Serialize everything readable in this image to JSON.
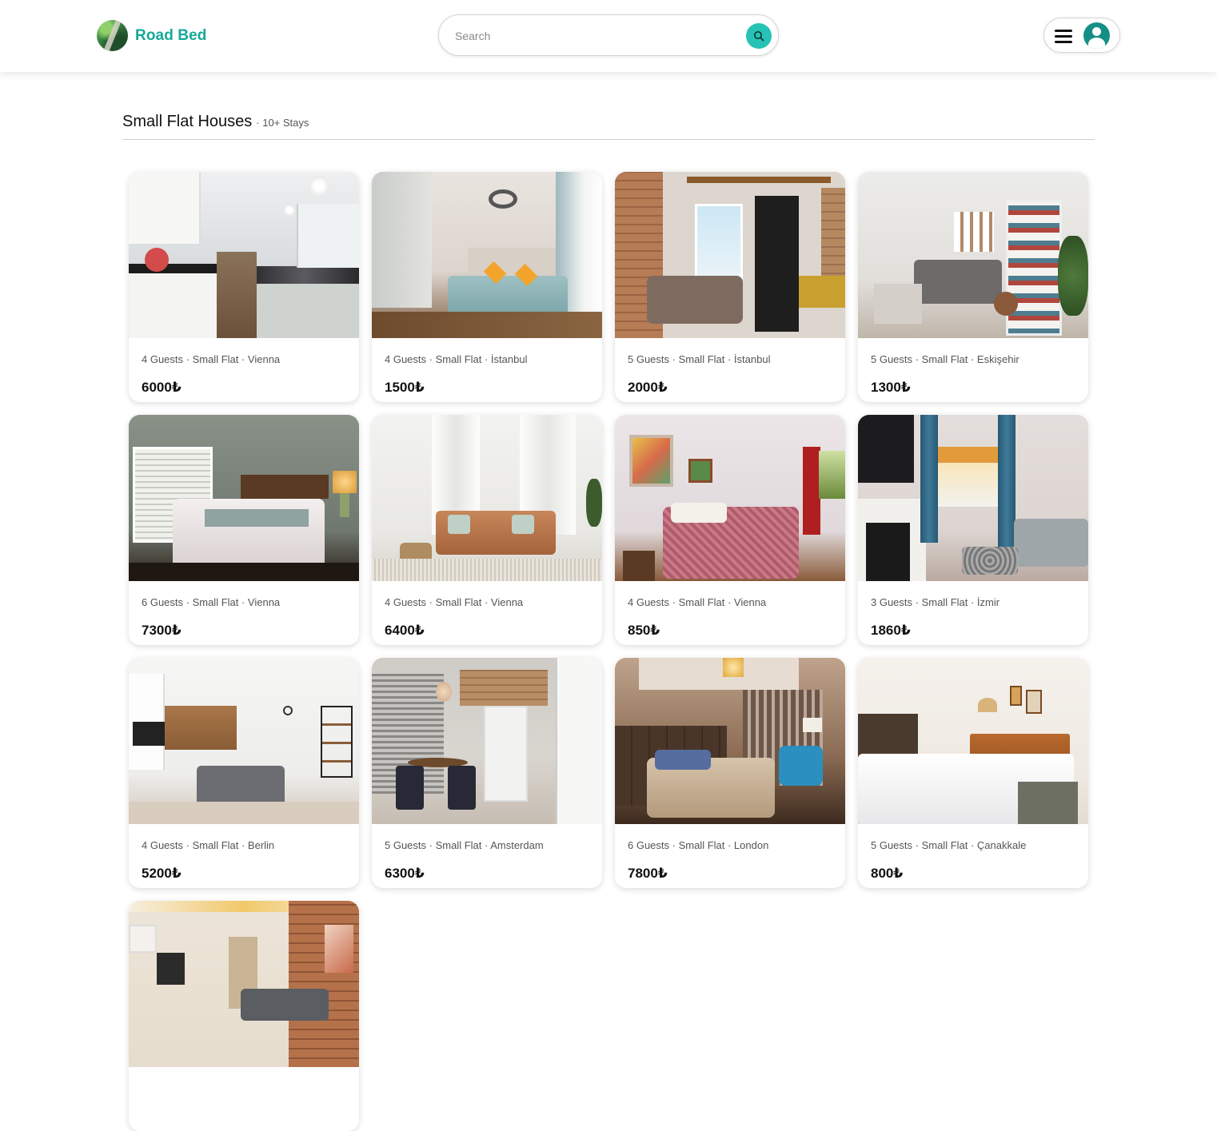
{
  "header": {
    "brand": "Road Bed",
    "search_placeholder": "Search"
  },
  "section": {
    "title": "Small Flat Houses",
    "subtitle": "· 10+ Stays"
  },
  "listings": [
    {
      "meta": "4 Guests · Small Flat · Vienna",
      "price": "6000₺"
    },
    {
      "meta": "4 Guests · Small Flat · İstanbul",
      "price": "1500₺"
    },
    {
      "meta": "5 Guests · Small Flat · İstanbul",
      "price": "2000₺"
    },
    {
      "meta": "5 Guests · Small Flat · Eskişehir",
      "price": "1300₺"
    },
    {
      "meta": "6 Guests · Small Flat · Vienna",
      "price": "7300₺"
    },
    {
      "meta": "4 Guests · Small Flat · Vienna",
      "price": "6400₺"
    },
    {
      "meta": "4 Guests · Small Flat · Vienna",
      "price": "850₺"
    },
    {
      "meta": "3 Guests · Small Flat · İzmir",
      "price": "1860₺"
    },
    {
      "meta": "4 Guests · Small Flat · Berlin",
      "price": "5200₺"
    },
    {
      "meta": "5 Guests · Small Flat · Amsterdam",
      "price": "6300₺"
    },
    {
      "meta": "6 Guests · Small Flat · London",
      "price": "7800₺"
    },
    {
      "meta": "5 Guests · Small Flat · Çanakkale",
      "price": "800₺"
    }
  ]
}
